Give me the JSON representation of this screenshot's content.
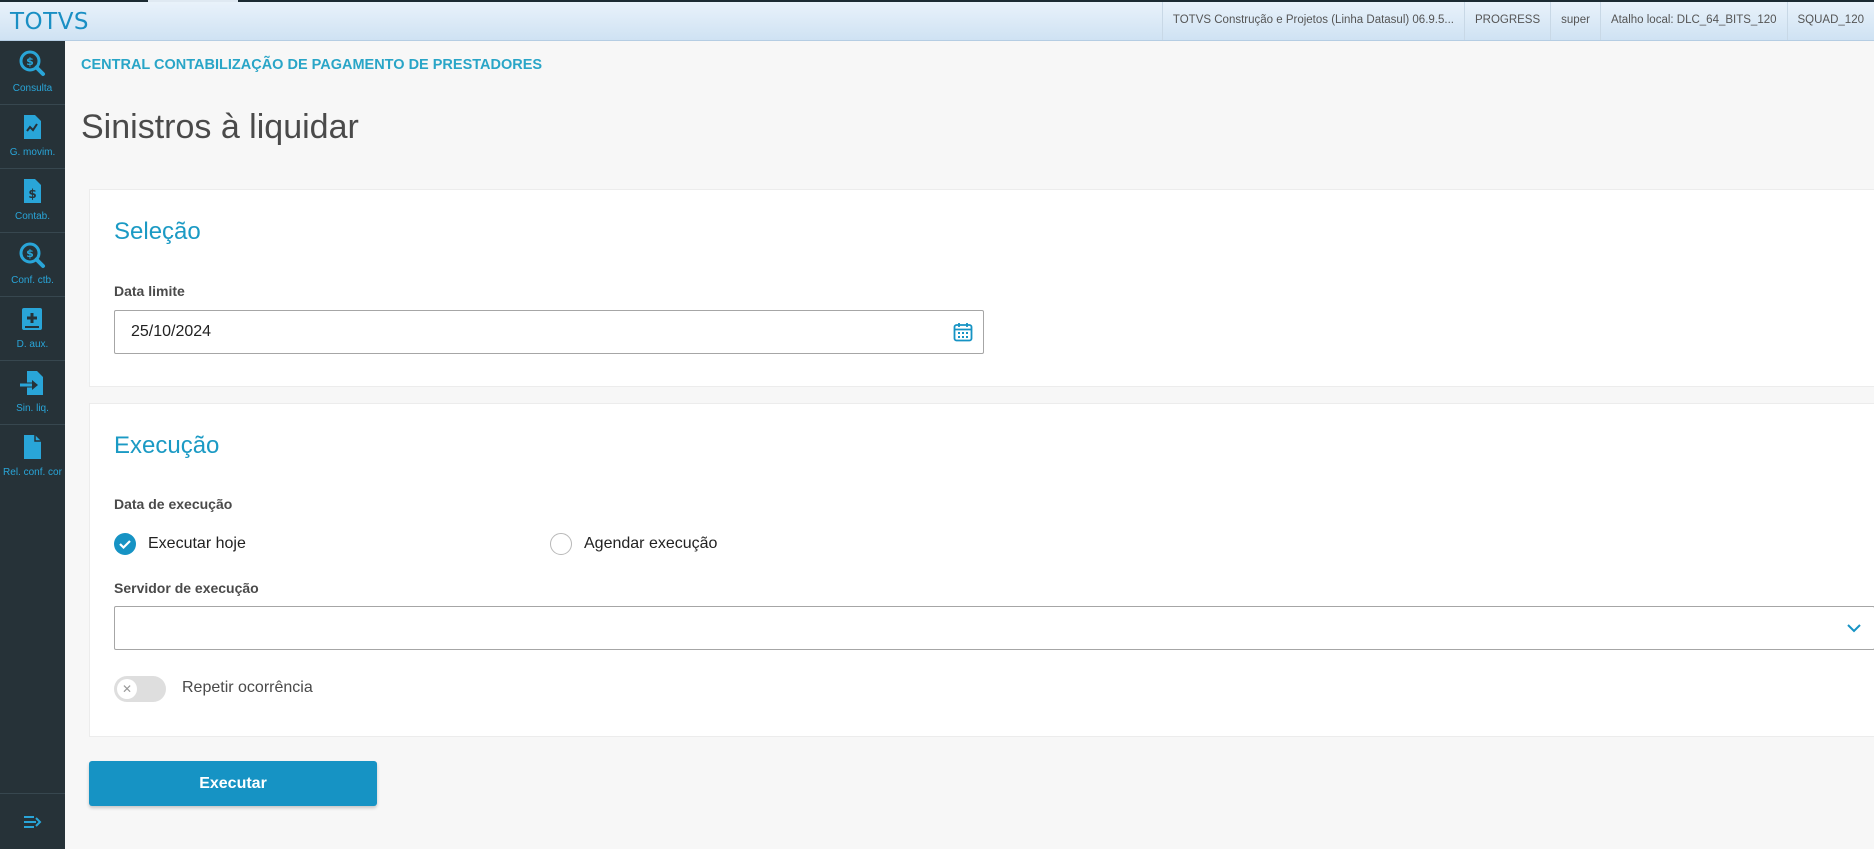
{
  "topbar": {
    "brand": "TOTVS",
    "info": [
      "TOTVS Construção e Projetos (Linha Datasul) 06.9.5...",
      "PROGRESS",
      "super",
      "Atalho local: DLC_64_BITS_120",
      "SQUAD_120"
    ]
  },
  "sidebar": {
    "items": [
      {
        "label": "Consulta",
        "icon": "search-dollar-icon"
      },
      {
        "label": "G. movim.",
        "icon": "file-chart-icon"
      },
      {
        "label": "Contab.",
        "icon": "file-dollar-icon"
      },
      {
        "label": "Conf. ctb.",
        "icon": "search-dollar-icon"
      },
      {
        "label": "D. aux.",
        "icon": "book-plus-icon"
      },
      {
        "label": "Sin. liq.",
        "icon": "file-export-icon"
      },
      {
        "label": "Rel. conf. cor",
        "icon": "file-icon"
      }
    ],
    "collapse_icon": "menu-collapse-icon"
  },
  "breadcrumb": "CENTRAL CONTABILIZAÇÃO DE PAGAMENTO DE PRESTADORES",
  "page_title": "Sinistros à liquidar",
  "selection": {
    "title": "Seleção",
    "date_limit_label": "Data limite",
    "date_limit_value": "25/10/2024"
  },
  "execution": {
    "title": "Execução",
    "date_label": "Data de execução",
    "options": [
      "Executar hoje",
      "Agendar execução"
    ],
    "selected_option": "Executar hoje",
    "server_label": "Servidor de execução",
    "server_value": "",
    "repeat_label": "Repetir ocorrência",
    "repeat_enabled": false
  },
  "run_button": "Executar",
  "colors": {
    "accent": "#1693c4",
    "sidebar": "#263238",
    "sidebar_label": "#29a5d8"
  }
}
